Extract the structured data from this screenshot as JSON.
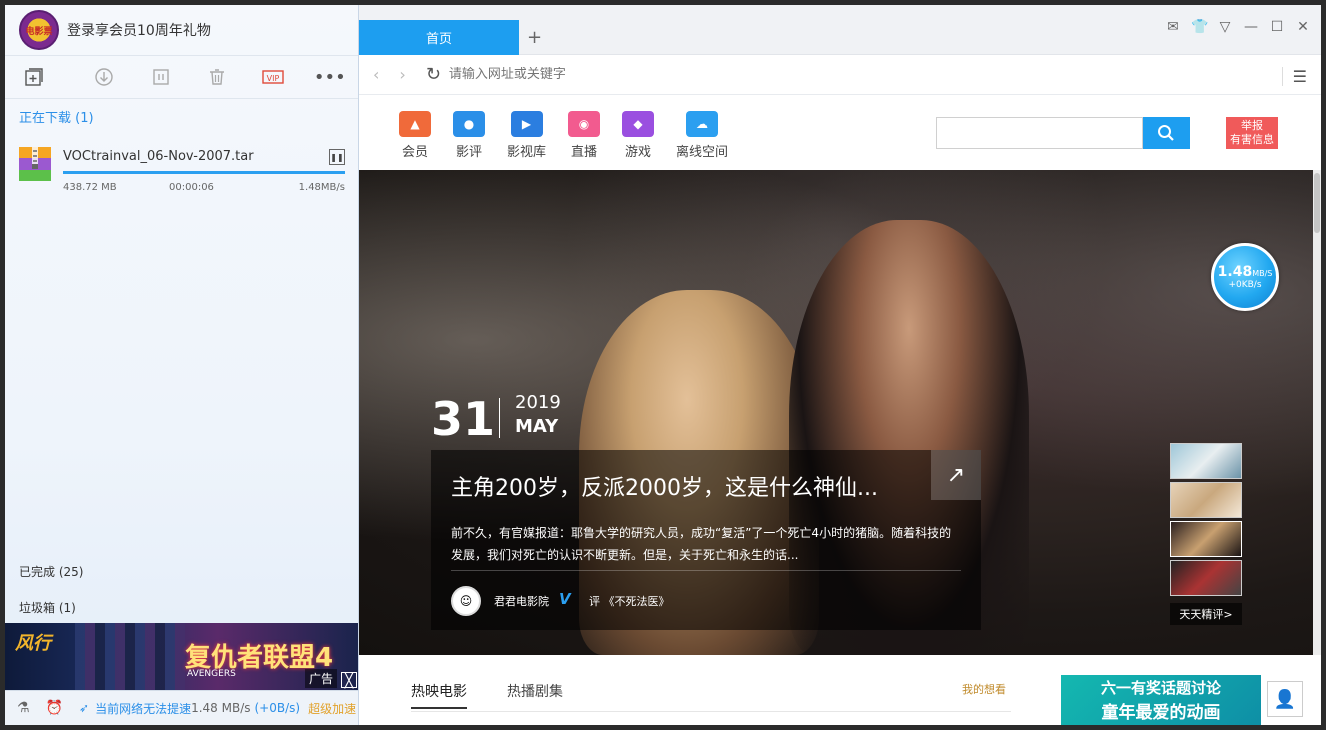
{
  "left": {
    "header_title": "登录享会员10周年礼物",
    "avatar_text": "电影票",
    "section_downloading": "正在下载 (1)",
    "download": {
      "filename": "VOCtrainval_06-Nov-2007.tar",
      "size": "438.72 MB",
      "elapsed": "00:00:06",
      "speed": "1.48MB/s",
      "progress": 1.0
    },
    "section_completed": "已完成 (25)",
    "section_trash": "垃圾箱 (1)",
    "ad": {
      "brand": "风行",
      "title": "复仇者联盟4",
      "sub": "AVENGERS",
      "tag": "广告",
      "close": "╳"
    },
    "status": {
      "network": "当前网络无法提速",
      "speed": "1.48 MB/s",
      "speedup": "(+0B/s)",
      "vip": "超级加速"
    }
  },
  "browser": {
    "tab_home": "首页",
    "tab_add": "+",
    "address_placeholder": "请输入网址或关键字",
    "categories": [
      {
        "label": "会员",
        "color": "#f06a3a"
      },
      {
        "label": "影评",
        "color": "#2b8fe8"
      },
      {
        "label": "影视库",
        "color": "#2b7ee0"
      },
      {
        "label": "直播",
        "color": "#f25b8f"
      },
      {
        "label": "游戏",
        "color": "#9a4fe0"
      },
      {
        "label": "离线空间",
        "color": "#2b9ff0"
      }
    ],
    "report": "举报\n有害信息",
    "hero": {
      "day": "31",
      "year": "2019",
      "month": "MAY",
      "title": "主角200岁，反派2000岁，这是什么神仙...",
      "desc": "前不久，有官媒报道：耶鲁大学的研究人员，成功“复活”了一个死亡4小时的猪脑。随着科技的发展，我们对死亡的认识不断更新。但是，关于死亡和永生的话...",
      "author": "君君电影院",
      "review": "评 《不死法医》",
      "daily": "天天精评>"
    },
    "speed_ball": {
      "value": "1.48",
      "unit": "MB/S",
      "up": "+0KB/s"
    },
    "bottom_tabs": [
      "热映电影",
      "热播剧集"
    ],
    "wish": "我的想看",
    "promo": {
      "line1": "六一有奖话题讨论",
      "line2": "童年最爱的动画"
    }
  }
}
